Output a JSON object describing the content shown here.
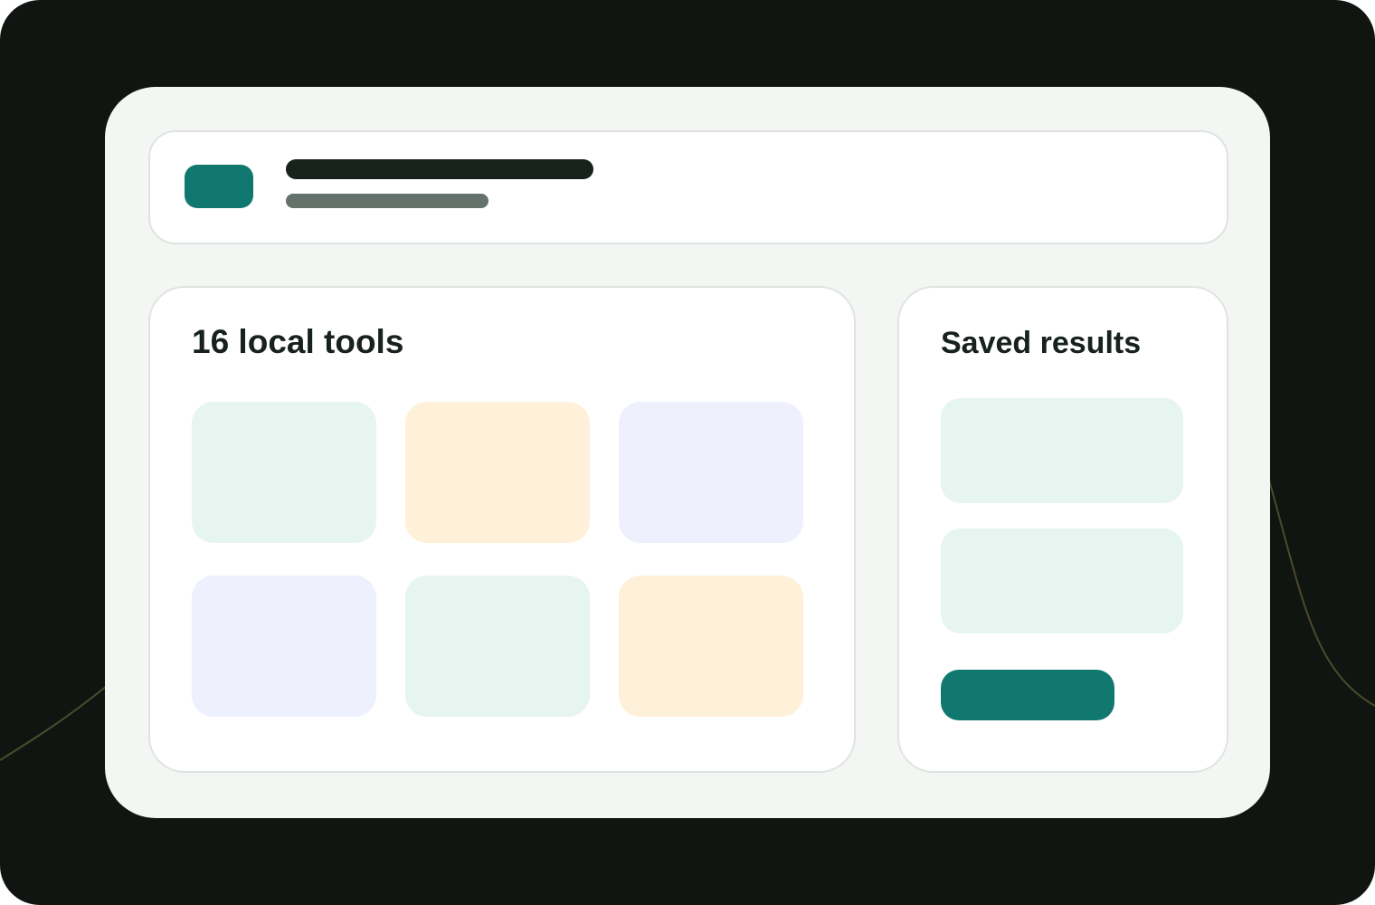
{
  "colors": {
    "outer_background": "#101511",
    "window_background": "#f4f6f3",
    "accent": "#11786f",
    "text_primary": "#17221d",
    "text_secondary": "#65726c",
    "tile_mint": "#e6f5f0",
    "tile_cream": "#fff1d9",
    "tile_lavender": "#eef0fe"
  },
  "header": {
    "logo_icon": "logo-icon"
  },
  "tools": {
    "title": "16 local tools",
    "tiles": [
      {
        "color": "#e6f5f0"
      },
      {
        "color": "#fff1d9"
      },
      {
        "color": "#eef0fe"
      },
      {
        "color": "#eef0fe"
      },
      {
        "color": "#e6f5f0"
      },
      {
        "color": "#fff1d9"
      }
    ]
  },
  "saved": {
    "title": "Saved results",
    "results_color": "#e6f5f0",
    "button_color": "#11786f"
  }
}
